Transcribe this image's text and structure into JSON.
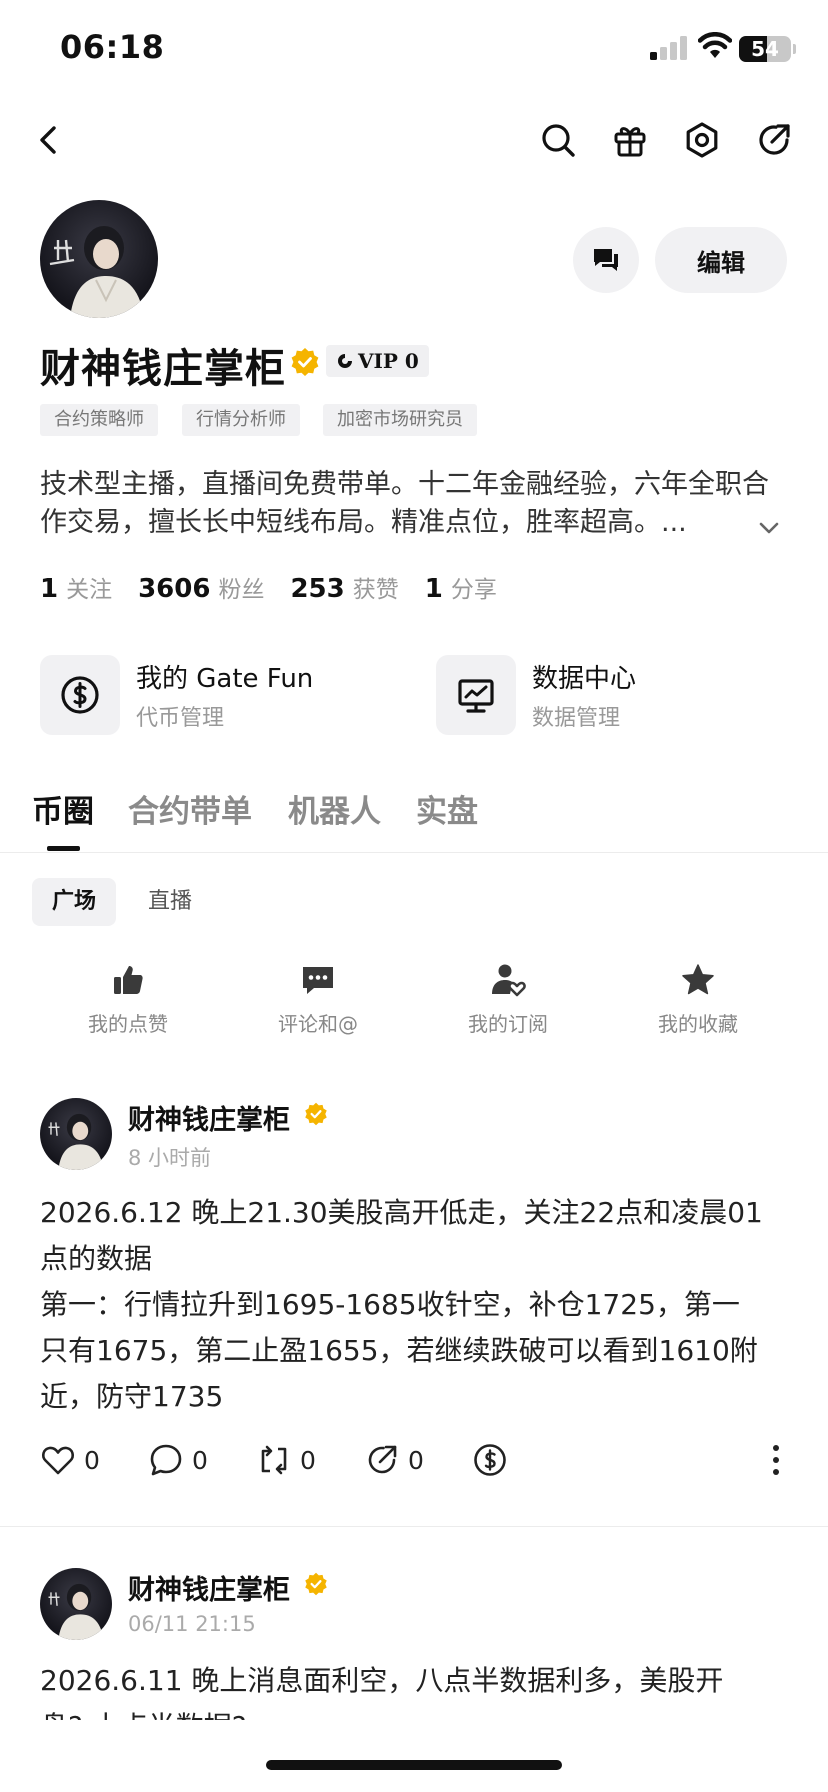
{
  "status_bar": {
    "time": "06:18",
    "battery": "54",
    "battery_level": 0.54
  },
  "nav": {
    "icons": [
      "back-icon",
      "search-icon",
      "gift-icon",
      "settings-icon",
      "share-icon"
    ]
  },
  "profile": {
    "name": "财神钱庄掌柜",
    "vip": "VIP 0",
    "message_icon": "chat-icon",
    "edit_label": "编辑",
    "tags": [
      "合约策略师",
      "行情分析师",
      "加密市场研究员"
    ],
    "bio": "技术型主播，直播间免费带单。十二年金融经验，六年全职合作交易，擅长长中短线布局。精准点位，胜率超高。...",
    "stats": [
      {
        "value": "1",
        "label": "关注"
      },
      {
        "value": "3606",
        "label": "粉丝"
      },
      {
        "value": "253",
        "label": "获赞"
      },
      {
        "value": "1",
        "label": "分享"
      }
    ]
  },
  "tools": [
    {
      "title": "我的 Gate Fun",
      "subtitle": "代币管理",
      "icon": "coin-icon"
    },
    {
      "title": "数据中心",
      "subtitle": "数据管理",
      "icon": "chart-monitor-icon"
    }
  ],
  "tabs": [
    "币圈",
    "合约带单",
    "机器人",
    "实盘"
  ],
  "subtabs": [
    "广场",
    "直播"
  ],
  "quick_actions": [
    {
      "label": "我的点赞",
      "icon": "thumbs-up-icon"
    },
    {
      "label": "评论和@",
      "icon": "comment-icon"
    },
    {
      "label": "我的订阅",
      "icon": "subscribe-icon"
    },
    {
      "label": "我的收藏",
      "icon": "star-icon"
    }
  ],
  "posts": [
    {
      "author": "财神钱庄掌柜",
      "time": "8 小时前",
      "body_lines": [
        "2026.6.12 晚上21.30美股高开低走，关注22点和凌晨01",
        "点的数据",
        "第一：行情拉升到1695-1685收针空，补仓1725，第一",
        "只有1675，第二止盈1655，若继续跌破可以看到1610附",
        "近，防守1735"
      ],
      "likes": "0",
      "comments": "0",
      "reposts": "0",
      "shares": "0"
    },
    {
      "author": "财神钱庄掌柜",
      "time": "06/11 21:15",
      "body_lines": [
        "2026.6.11  晚上消息面利空，八点半数据利多，美股开",
        "盘?  十点半数据?"
      ]
    }
  ]
}
